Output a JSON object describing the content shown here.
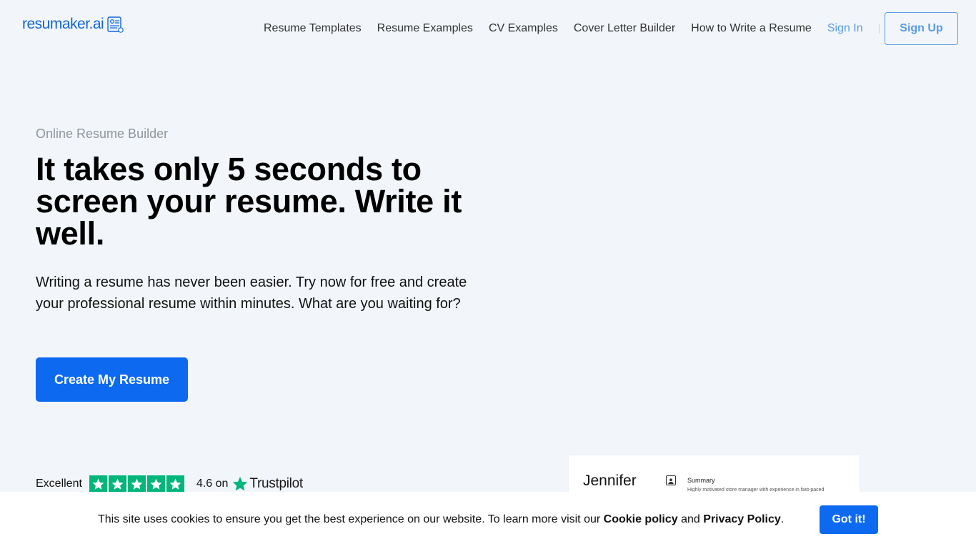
{
  "header": {
    "logo_text": "resumaker.ai",
    "logo_icon": "resume-document-icon",
    "nav": [
      {
        "label": "Resume Templates"
      },
      {
        "label": "Resume Examples"
      },
      {
        "label": "CV Examples"
      },
      {
        "label": "Cover Letter Builder"
      },
      {
        "label": "How to Write a Resume"
      }
    ],
    "sign_in": "Sign In",
    "sign_up": "Sign Up"
  },
  "hero": {
    "eyebrow": "Online Resume Builder",
    "title": "It takes only 5 seconds to screen your resume. Write it well.",
    "subtitle": "Writing a resume has never been easier. Try now for free and create your professional resume within minutes. What are you waiting for?",
    "cta": "Create My Resume"
  },
  "trust": {
    "label": "Excellent",
    "stars": 5,
    "score": "4.6 on",
    "brand": "Trustpilot",
    "star_color": "#00b67a"
  },
  "resume_preview": {
    "name": "Jennifer",
    "section": "Summary",
    "summary": "Highly motivated store manager with experience in fast-paced"
  },
  "cookie": {
    "text_before": "This site uses cookies to ensure you get the best experience on our website. To learn more visit our ",
    "cookie_link": "Cookie policy",
    "and": " and ",
    "privacy_link": "Privacy Policy",
    "text_after": ".",
    "button": "Got it!"
  },
  "colors": {
    "accent": "#0d6af0",
    "link": "#5a9be8",
    "background": "#f2f6fa"
  }
}
